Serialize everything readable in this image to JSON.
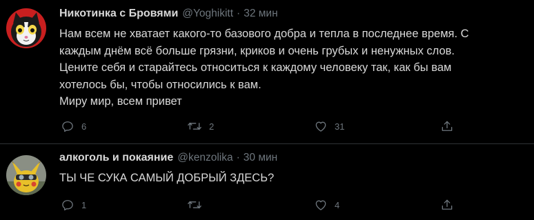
{
  "colors": {
    "background": "#000000",
    "text": "#d9d9d9",
    "muted": "#6e767d",
    "divider": "#2f3336"
  },
  "tweets": [
    {
      "name": "Никотинка с Бровями",
      "handle": "@Yoghikitt",
      "separator": "·",
      "time": "32 мин",
      "avatar": "cat-avatar",
      "lines": [
        "Нам всем не хватает какого-то базового добра и тепла в последнее время. С",
        "каждым днём всё больше грязни, криков и очень грубых и ненужных слов.",
        "Цените себя и старайтесь относиться к каждому человеку так, как бы вам",
        "хотелось бы, чтобы относились к вам.",
        "Миру мир, всем привет"
      ],
      "actions": {
        "reply_count": "6",
        "retweet_count": "2",
        "like_count": "31",
        "reply_icon": "reply-icon",
        "retweet_icon": "retweet-icon",
        "like_icon": "heart-icon",
        "share_icon": "share-icon"
      }
    },
    {
      "name": "алкоголь и покаяние",
      "handle": "@kenzolika",
      "separator": "·",
      "time": "30 мин",
      "avatar": "pikachu-avatar",
      "lines": [
        "ТЫ ЧЕ СУКА САМЫЙ ДОБРЫЙ ЗДЕСЬ?"
      ],
      "actions": {
        "reply_count": "1",
        "retweet_count": "",
        "like_count": "4",
        "reply_icon": "reply-icon",
        "retweet_icon": "retweet-icon",
        "like_icon": "heart-icon",
        "share_icon": "share-icon"
      }
    }
  ]
}
